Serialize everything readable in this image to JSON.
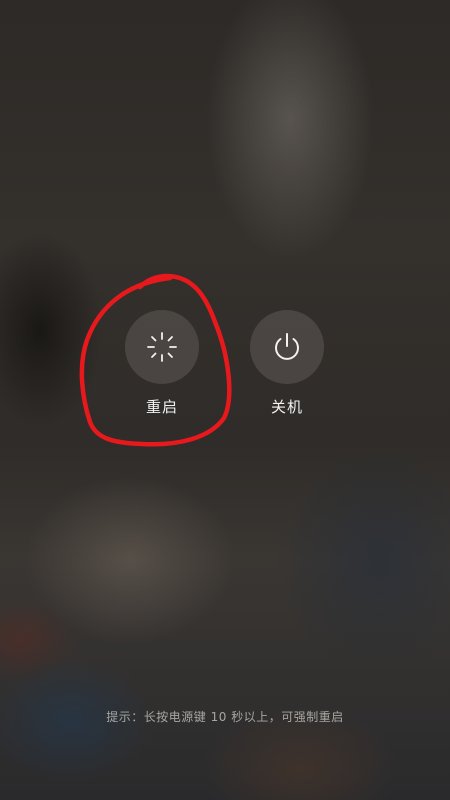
{
  "actions": {
    "restart": {
      "label": "重启",
      "icon": "spinner-icon"
    },
    "power_off": {
      "label": "关机",
      "icon": "power-icon"
    }
  },
  "hint": {
    "text": "提示：长按电源键 10 秒以上，可强制重启"
  },
  "colors": {
    "annotation": "#e8191c",
    "button_bg": "#5f5a55",
    "label": "#f2f2f2"
  }
}
